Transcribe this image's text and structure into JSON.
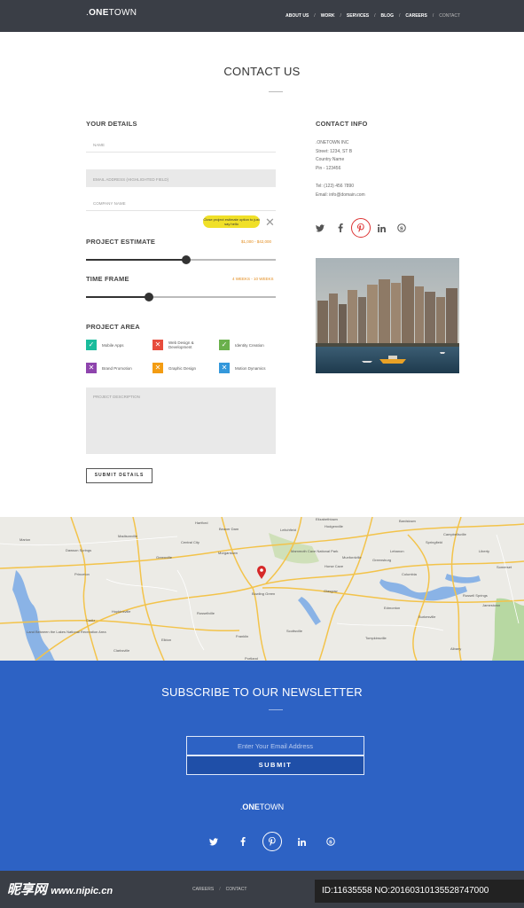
{
  "header": {
    "logo_prefix": ".",
    "logo_bold": "ONE",
    "logo_thin": "TOWN",
    "nav": [
      "ABOUT US",
      "WORK",
      "SERVICES",
      "BLOG",
      "CAREERS",
      "CONTACT"
    ],
    "sep": "/"
  },
  "page": {
    "title": "CONTACT US"
  },
  "details": {
    "heading": "YOUR DETAILS",
    "name_placeholder": "NAME",
    "email_placeholder": "EMAIL ADDRESS (HIGHLIGHTED FIELD)",
    "company_placeholder": "COMPANY NAME",
    "tooltip": "Close project estimate option to just say hello",
    "close_icon": "close-icon",
    "estimate": {
      "label": "PROJECT ESTIMATE",
      "range": "$1,000 - $42,000",
      "value": 0.53
    },
    "timeframe": {
      "label": "TIME FRAME",
      "range": "4 WEEKS - 10 WEEKS",
      "value": 0.33
    },
    "area": {
      "heading": "PROJECT AREA",
      "items": [
        {
          "label": "Mobile Apps",
          "state": "check",
          "color": "#1abc9c"
        },
        {
          "label": "Web Design &",
          "label2": "Development",
          "state": "cross",
          "color": "#e74c3c"
        },
        {
          "label": "Identity Creation",
          "state": "check",
          "color": "#6ab04c"
        },
        {
          "label": "Brand Promotion",
          "state": "cross",
          "color": "#8e44ad"
        },
        {
          "label": "Graphic Design",
          "state": "cross",
          "color": "#f39c12"
        },
        {
          "label": "Motion Dynamics",
          "state": "cross",
          "color": "#3498db"
        }
      ]
    },
    "description_placeholder": "PROJECT DESCRIPTION",
    "submit": "SUBMIT DETAILS"
  },
  "contact": {
    "heading": "CONTACT INFO",
    "lines": [
      ".ONETOWN INC",
      "Street: 1234, ST B",
      "Country Name",
      "Pin - 123456"
    ],
    "tel": "Tel: (123) 456 7890",
    "email": "Email: info@domain.com",
    "social": [
      "twitter-icon",
      "facebook-icon",
      "pinterest-icon",
      "linkedin-icon",
      "skype-icon"
    ]
  },
  "map": {
    "labels": [
      "Princeton",
      "Hopkinsville",
      "Russellville",
      "Franklin",
      "Glasgow",
      "Columbia",
      "Campbellsville",
      "Madisonville",
      "Morgantown",
      "Greenville",
      "Leitchfield",
      "Hodgenville",
      "Mammoth Cave National Park",
      "Horse Cave",
      "Munfordville",
      "Bowling Green",
      "Scottsville",
      "Portland",
      "Clarksville",
      "Land Between the Lakes National Recreation Area",
      "Albany",
      "Jamestown",
      "Somerset",
      "Burkesville",
      "Tompkinsville",
      "Edmonton",
      "Hartford",
      "Central City",
      "Elizabethtown",
      "Bardstown",
      "Springfield",
      "Lebanon",
      "Marion",
      "Dawson Springs",
      "Elkton",
      "Cadiz",
      "Greensburg",
      "Liberty",
      "Russell Springs",
      "Beaver Dam"
    ]
  },
  "newsletter": {
    "title": "SUBSCRIBE TO OUR NEWSLETTER",
    "email_placeholder": "Enter Your Email Address",
    "submit": "SUBMIT",
    "logo_prefix": ".",
    "logo_bold": "ONE",
    "logo_thin": "TOWN"
  },
  "footer": {
    "nav": [
      "CAREERS",
      "CONTACT"
    ],
    "sep": "/",
    "brand": "昵享网",
    "brand_url": "www.nipic.cn",
    "id_text": "ID:11635558 NO:20160310135528747000"
  },
  "colors": {
    "accent": "#2d62c4",
    "header": "#3a3e46",
    "orange": "#e28a1b",
    "tooltip": "#f0e028",
    "pin": "#d62828"
  }
}
